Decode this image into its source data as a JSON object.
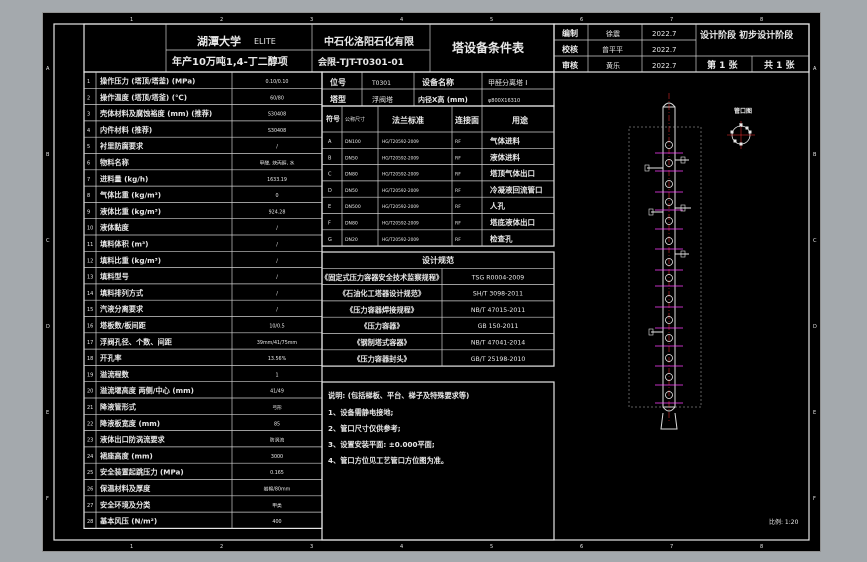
{
  "header": {
    "university": "湖潭大学",
    "university_en": "ELITE",
    "project": "年产10万吨1,4-丁二醇项",
    "company": "中石化洛阳石化有限",
    "drawing_no": "会限-TJT-T0301-01",
    "doc_title": "塔设备条件表"
  },
  "signoff": {
    "rows": [
      {
        "role": "编制",
        "name": "徐震",
        "date": "2022.7"
      },
      {
        "role": "校核",
        "name": "曾平平",
        "date": "2022.7"
      },
      {
        "role": "审核",
        "name": "黄乐",
        "date": "2022.7"
      }
    ],
    "stage": "设计阶段 初步设计阶段",
    "sheet": "第 1 张",
    "total": "共 1 张"
  },
  "params": [
    {
      "no": "1",
      "name": "操作压力 (塔顶/塔釜) (MPa)",
      "value": "0.10/0.10"
    },
    {
      "no": "2",
      "name": "操作温度 (塔顶/塔釜) (℃)",
      "value": "60/80"
    },
    {
      "no": "3",
      "name": "壳体材料及腐蚀裕度 (mm) (推荐)",
      "value": "S30408"
    },
    {
      "no": "4",
      "name": "内件材料 (推荐)",
      "value": "S30408"
    },
    {
      "no": "5",
      "name": "衬里防腐要求",
      "value": "/"
    },
    {
      "no": "6",
      "name": "物料名称",
      "value": "甲醛, 炔丙醇, 水"
    },
    {
      "no": "7",
      "name": "进料量 (kg/h)",
      "value": "1633.19"
    },
    {
      "no": "8",
      "name": "气体比重 (kg/m³)",
      "value": "0"
    },
    {
      "no": "9",
      "name": "液体比重 (kg/m³)",
      "value": "924.28"
    },
    {
      "no": "10",
      "name": "液体黏度",
      "value": "/"
    },
    {
      "no": "11",
      "name": "填料体积 (m³)",
      "value": "/"
    },
    {
      "no": "12",
      "name": "填料比重 (kg/m³)",
      "value": "/"
    },
    {
      "no": "13",
      "name": "填料型号",
      "value": "/"
    },
    {
      "no": "14",
      "name": "填料排列方式",
      "value": "/"
    },
    {
      "no": "15",
      "name": "汽液分离要求",
      "value": "/"
    },
    {
      "no": "16",
      "name": "塔板数/板间距",
      "value": "10/0.5"
    },
    {
      "no": "17",
      "name": "浮阀孔径、个数、间距",
      "value": "39mm/41/75mm"
    },
    {
      "no": "18",
      "name": "开孔率",
      "value": "13.56%"
    },
    {
      "no": "19",
      "name": "溢流程数",
      "value": "1"
    },
    {
      "no": "20",
      "name": "溢流堰高度 两侧/中心 (mm)",
      "value": "41/49"
    },
    {
      "no": "21",
      "name": "降液管形式",
      "value": "弓形"
    },
    {
      "no": "22",
      "name": "降液板宽度 (mm)",
      "value": "85"
    },
    {
      "no": "23",
      "name": "液体出口防涡流要求",
      "value": "防涡流"
    },
    {
      "no": "24",
      "name": "裙座高度 (mm)",
      "value": "3000"
    },
    {
      "no": "25",
      "name": "安全装置起跳压力 (MPa)",
      "value": "0.165"
    },
    {
      "no": "26",
      "name": "保温材料及厚度",
      "value": "岩棉/80mm"
    },
    {
      "no": "27",
      "name": "安全环境及分类",
      "value": "甲类"
    },
    {
      "no": "28",
      "name": "基本风压 (N/m²)",
      "value": "400"
    }
  ],
  "equipment": {
    "code_label": "位号",
    "code": "T0301",
    "name_label": "设备名称",
    "name": "甲醛分离塔 I",
    "type_label": "塔型",
    "type": "浮阀塔",
    "diameter_label": "内径X高 (mm)",
    "diameter": "φ800X16310"
  },
  "nozzle_header": {
    "no": "符号",
    "size": "公称尺寸",
    "std": "法兰标准",
    "face": "连接面",
    "use": "用途"
  },
  "nozzles": [
    {
      "no": "A",
      "size": "DN100",
      "std": "HG/T20592-2009",
      "face": "RF",
      "use": "气体进料"
    },
    {
      "no": "B",
      "size": "DN50",
      "std": "HG/T20592-2009",
      "face": "RF",
      "use": "液体进料"
    },
    {
      "no": "C",
      "size": "DN80",
      "std": "HG/T20592-2009",
      "face": "RF",
      "use": "塔顶气体出口"
    },
    {
      "no": "D",
      "size": "DN50",
      "std": "HG/T20592-2009",
      "face": "RF",
      "use": "冷凝液回流管口"
    },
    {
      "no": "E",
      "size": "DN500",
      "std": "HG/T20592-2009",
      "face": "RF",
      "use": "人孔"
    },
    {
      "no": "F",
      "size": "DN80",
      "std": "HG/T20592-2009",
      "face": "RF",
      "use": "塔底液体出口"
    },
    {
      "no": "G",
      "size": "DN20",
      "std": "HG/T20592-2009",
      "face": "RF",
      "use": "检查孔"
    }
  ],
  "standards_title": "设计规范",
  "standards": [
    {
      "name": "《固定式压力容器安全技术监察规程》",
      "code": "TSG R0004-2009"
    },
    {
      "name": "《石油化工塔器设计规范》",
      "code": "SH/T 3098-2011"
    },
    {
      "name": "《压力容器焊接规程》",
      "code": "NB/T 47015-2011"
    },
    {
      "name": "《压力容器》",
      "code": "GB 150-2011"
    },
    {
      "name": "《钢制塔式容器》",
      "code": "NB/T 47041-2014"
    },
    {
      "name": "《压力容器封头》",
      "code": "GB/T 25198-2010"
    }
  ],
  "notes_title": "说明: (包括梯板、平台、梯子及特殊要求等)",
  "notes": [
    "1、设备需静电接地;",
    "2、管口尺寸仅供参考;",
    "3、设置安装平面: ±0.000平面;",
    "4、管口方位见工艺管口方位图为准。"
  ],
  "drawing": {
    "orientation_label": "管口图",
    "north": "N",
    "scale": "比例: 1:20",
    "col_nums": [
      "1",
      "2",
      "3",
      "4",
      "5",
      "6",
      "7",
      "8"
    ],
    "row_letters": [
      "A",
      "B",
      "C",
      "D",
      "E",
      "F"
    ]
  }
}
